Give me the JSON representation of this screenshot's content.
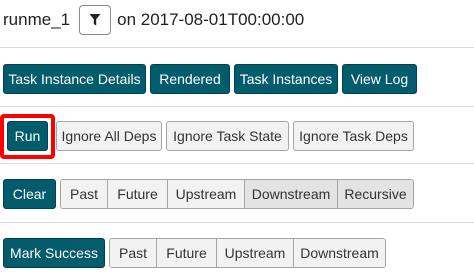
{
  "header": {
    "dag_run": "runme_1",
    "date_text": "on 2017-08-01T00:00:00"
  },
  "row1": {
    "task_instance_details": "Task Instance Details",
    "rendered": "Rendered",
    "task_instances": "Task Instances",
    "view_log": "View Log"
  },
  "row2": {
    "run": "Run",
    "ignore_all_deps": "Ignore All Deps",
    "ignore_task_state": "Ignore Task State",
    "ignore_task_deps": "Ignore Task Deps"
  },
  "row3": {
    "clear": "Clear",
    "options": [
      "Past",
      "Future",
      "Upstream",
      "Downstream",
      "Recursive"
    ]
  },
  "row4": {
    "mark_success": "Mark Success",
    "options": [
      "Past",
      "Future",
      "Upstream",
      "Downstream"
    ]
  },
  "colors": {
    "primary": "#035c6b",
    "highlight": "#ff0000"
  }
}
